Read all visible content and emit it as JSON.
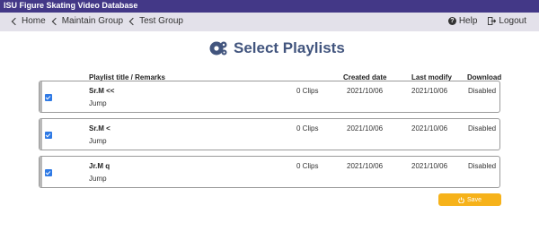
{
  "app": {
    "title": "ISU Figure Skating Video Database"
  },
  "nav": {
    "breadcrumbs": [
      "Home",
      "Maintain Group",
      "Test Group"
    ],
    "help": "Help",
    "logout": "Logout"
  },
  "page": {
    "title": "Select Playlists"
  },
  "table": {
    "headers": {
      "title": "Playlist title / Remarks",
      "created": "Created date",
      "modified": "Last modify",
      "download": "Download"
    },
    "rows": [
      {
        "title": "Sr.M <<",
        "remarks": "Jump",
        "clips": "0 Clips",
        "created": "2021/10/06",
        "modified": "2021/10/06",
        "download": "Disabled",
        "checked": true
      },
      {
        "title": "Sr.M <",
        "remarks": "Jump",
        "clips": "0 Clips",
        "created": "2021/10/06",
        "modified": "2021/10/06",
        "download": "Disabled",
        "checked": true
      },
      {
        "title": "Jr.M q",
        "remarks": "Jump",
        "clips": "0 Clips",
        "created": "2021/10/06",
        "modified": "2021/10/06",
        "download": "Disabled",
        "checked": true
      }
    ]
  },
  "actions": {
    "save_label": "Save"
  },
  "colors": {
    "header_bg": "#433887",
    "nav_bg": "#e3e1ea",
    "title_color": "#42557e",
    "save_bg": "#f6b21a",
    "checkbox": "#2f7ae5"
  },
  "icons": {
    "back": "chevron-left-icon",
    "help": "help-icon",
    "logout": "logout-icon",
    "heading": "gears-icon",
    "save": "power-icon"
  }
}
